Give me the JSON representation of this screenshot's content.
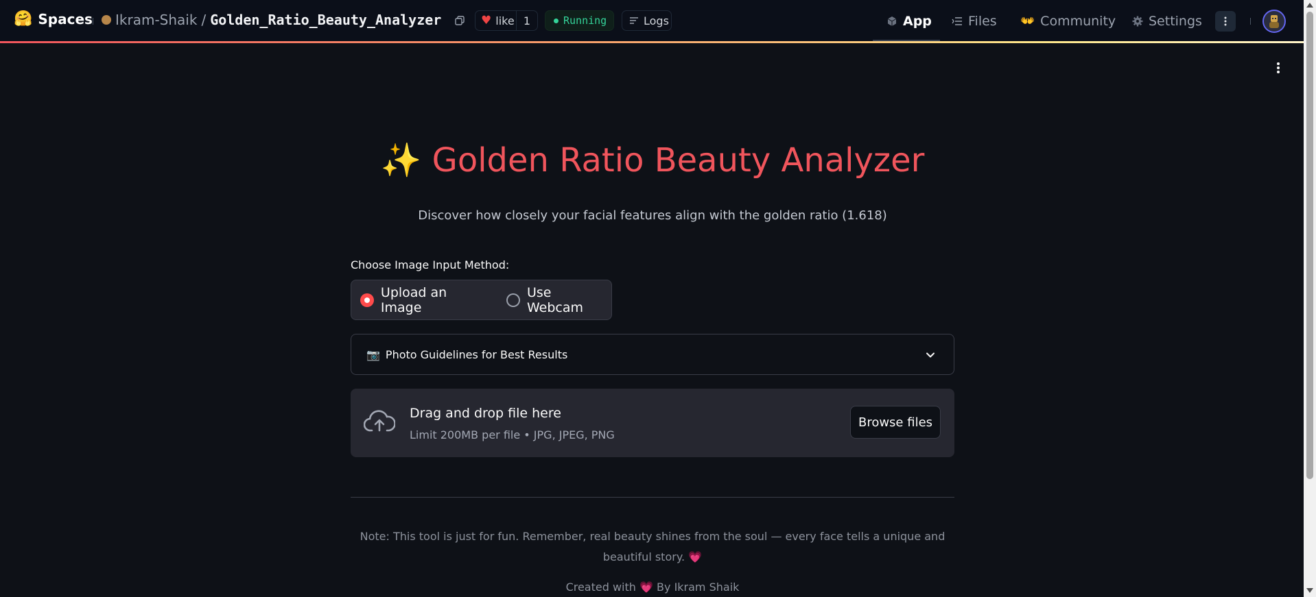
{
  "header": {
    "brand_emoji": "🤗",
    "brand_name": "Spaces",
    "owner": "Ikram-Shaik",
    "slash": "/",
    "repo_name": "Golden_Ratio_Beauty_Analyzer",
    "like_label": "like",
    "like_count": "1",
    "status": "Running",
    "logs_label": "Logs",
    "nav": {
      "app": "App",
      "files": "Files",
      "community": "Community",
      "settings": "Settings"
    },
    "community_emoji": "👐",
    "accent_colors": {
      "running": "#34d399",
      "heart": "#ef4444",
      "avatar_ring": "#6366f1"
    }
  },
  "main": {
    "title_emoji": "✨",
    "title": "Golden Ratio Beauty Analyzer",
    "subtitle": "Discover how closely your facial features align with the golden ratio (1.618)",
    "input_method_label": "Choose Image Input Method:",
    "radio_options": [
      {
        "label": "Upload an Image",
        "selected": true
      },
      {
        "label": "Use Webcam",
        "selected": false
      }
    ],
    "expander": {
      "emoji": "📷",
      "label": "Photo Guidelines for Best Results"
    },
    "uploader": {
      "title": "Drag and drop file here",
      "limit": "Limit 200MB per file • JPG, JPEG, PNG",
      "browse_label": "Browse files"
    },
    "note": "Note: This tool is just for fun. Remember, real beauty shines from the soul — every face tells a unique and beautiful story.",
    "note_emoji": "💗",
    "credit_prefix": "Created with",
    "credit_emoji": "💗",
    "credit_suffix": "By Ikram Shaik",
    "accent_color": "#f0555c"
  }
}
